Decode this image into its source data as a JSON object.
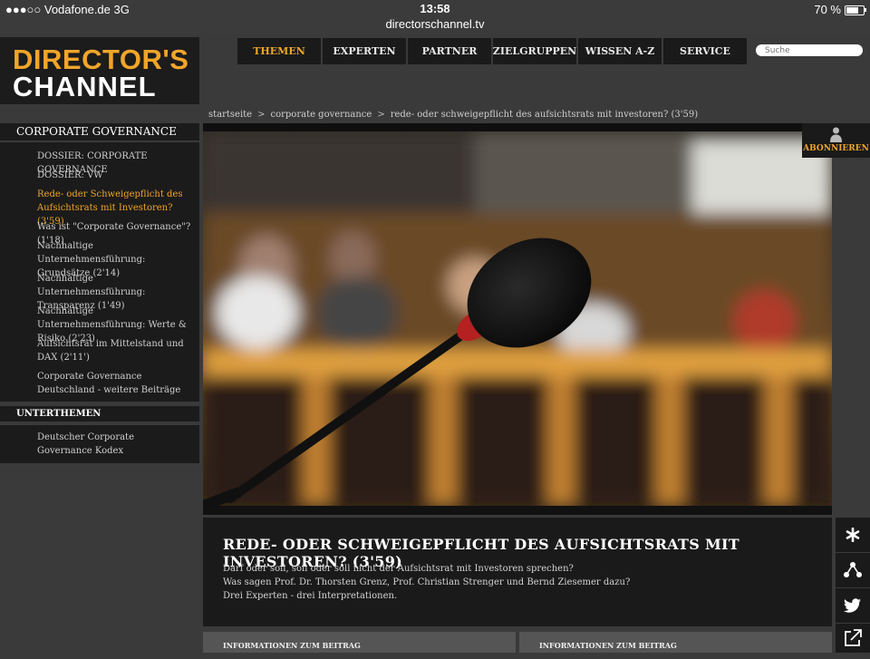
{
  "status_bar": {
    "carrier": "●●●○○ Vodafone.de  3G",
    "time": "13:58",
    "url": "directorschannel.tv",
    "battery": "70 %"
  },
  "logo": {
    "line1": "DIRECTOR'S",
    "line2": "CHANNEL"
  },
  "nav": {
    "tabs": [
      "THEMEN",
      "EXPERTEN",
      "PARTNER",
      "ZIELGRUPPEN",
      "WISSEN A-Z",
      "SERVICE"
    ],
    "active": "THEMEN",
    "search_placeholder": "Suche"
  },
  "breadcrumb": {
    "items": [
      "startseite",
      "corporate governance",
      "rede- oder schweigepflicht des aufsichtsrats mit investoren? (3'59)"
    ],
    "separator": ">"
  },
  "sidebar": {
    "section_title": "CORPORATE GOVERNANCE",
    "items": [
      {
        "label": "DOSSIER: CORPORATE GOVERNANCE"
      },
      {
        "label": "DOSSIER: VW"
      },
      {
        "label": "Rede- oder Schweigepflicht des Aufsichtsrats mit Investoren? (3'59)",
        "active": true
      },
      {
        "label": "Was ist \"Corporate Governance\"? (1'18)"
      },
      {
        "label": "Nachhaltige Unternehmensführung: Grundsätze (2'14)"
      },
      {
        "label": "Nachhaltige Unternehmensführung: Transparenz (1'49)"
      },
      {
        "label": "Nachhaltige Unternehmensführung: Werte & Risiko (2'23)"
      },
      {
        "label": "Aufsichtsrat im Mittelstand und DAX (2'11')"
      },
      {
        "label": "Corporate Governance Deutschland - weitere Beiträge"
      }
    ],
    "subtopics_title": "UNTERTHEMEN",
    "subtopics": [
      {
        "label": "Deutscher Corporate Governance Kodex"
      }
    ]
  },
  "subscribe_label": "ABONNIEREN",
  "article": {
    "title": "REDE- ODER SCHWEIGEPFLICHT DES AUFSICHTSRATS MIT INVESTOREN? (3'59)",
    "description": [
      "Darf oder soll, soll oder soll nicht der Aufsichtsrat mit Investoren sprechen?",
      "Was sagen Prof. Dr. Thorsten Grenz, Prof. Christian Strenger und Bernd Ziesemer dazu?",
      "Drei Experten - drei Interpretationen."
    ]
  },
  "info_sections": [
    "INFORMATIONEN ZUM BEITRAG",
    "INFORMATIONEN ZUM BEITRAG"
  ],
  "social_icons": [
    "asterisk-icon",
    "share-icon",
    "twitter-icon",
    "external-link-icon"
  ],
  "colors": {
    "accent": "#f0a52a",
    "panel": "#1b1b1b",
    "background": "#3a3a3a"
  }
}
